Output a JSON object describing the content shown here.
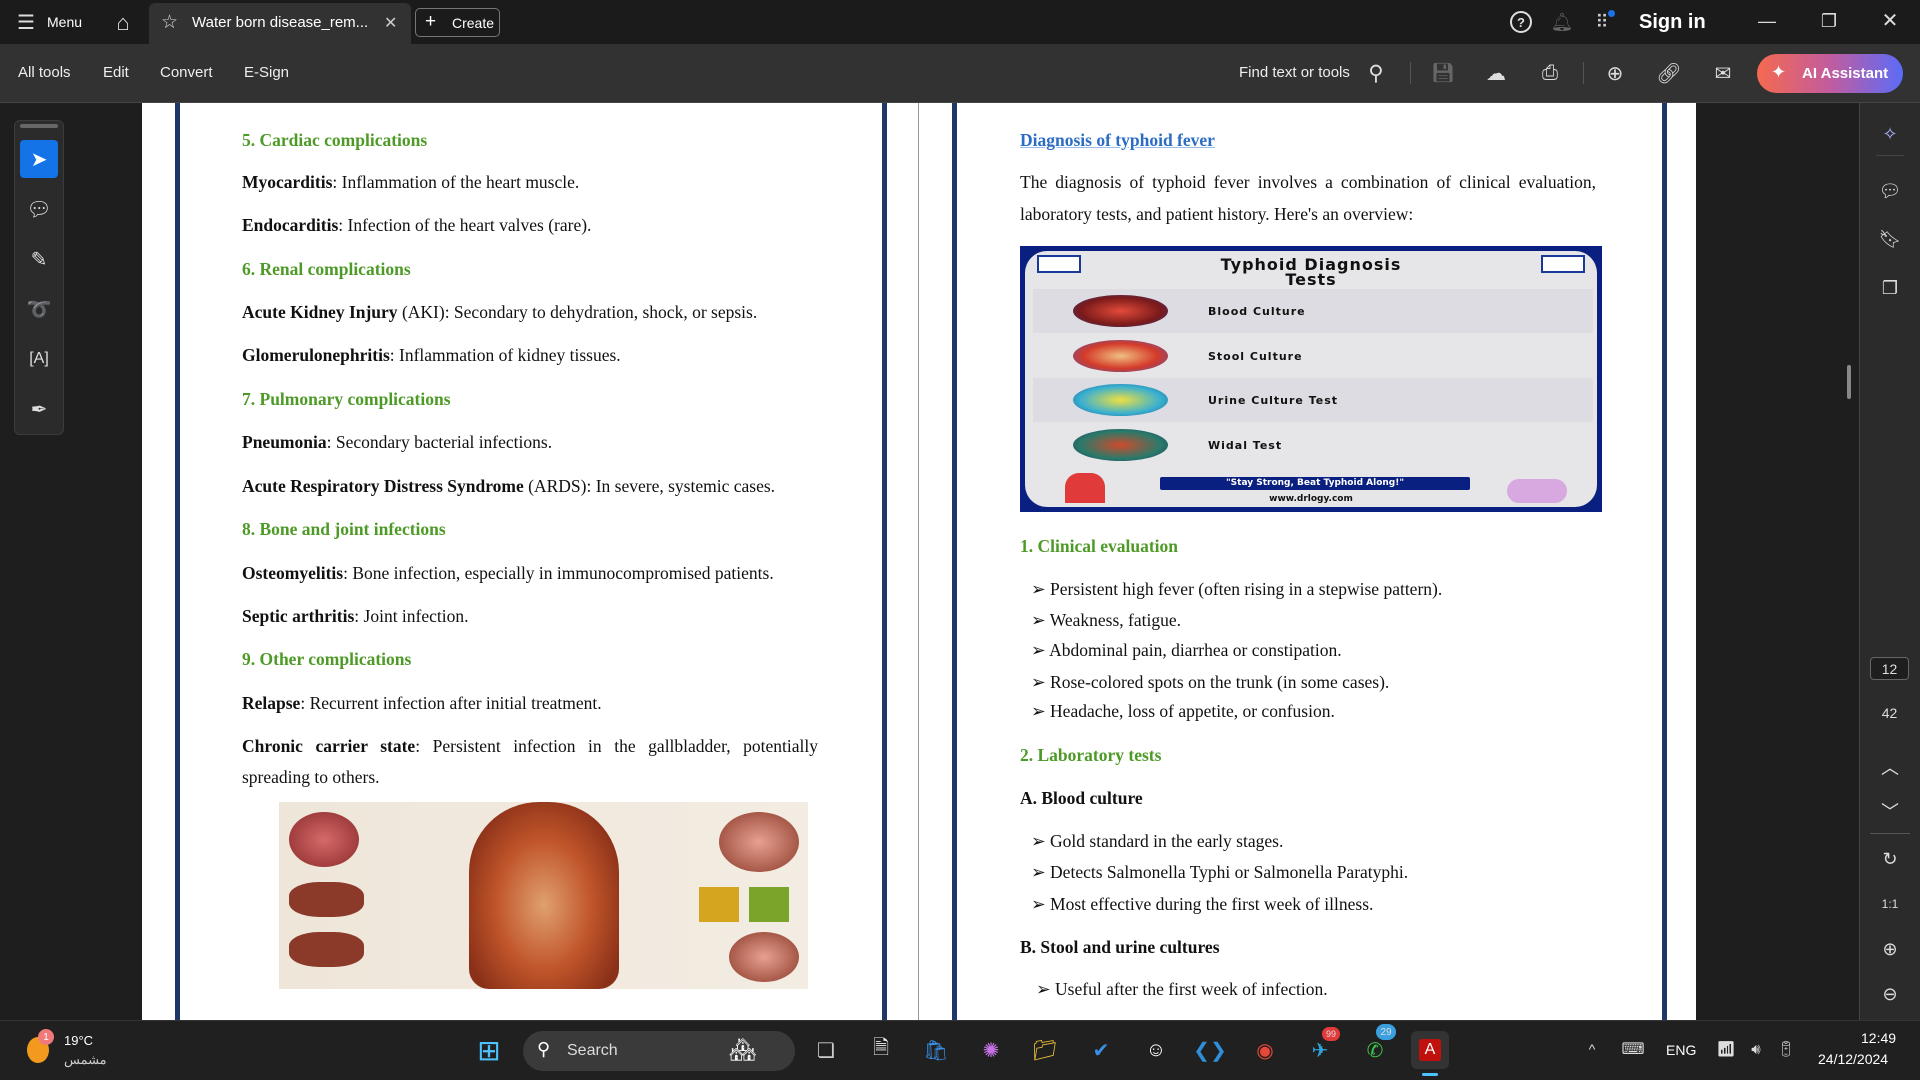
{
  "titlebar": {
    "menu": "Menu",
    "tab_title": "Water born disease_rem...",
    "create": "Create",
    "sign_in": "Sign in"
  },
  "toolbar": {
    "all_tools": "All tools",
    "edit": "Edit",
    "convert": "Convert",
    "esign": "E-Sign",
    "find": "Find text or tools",
    "ai": "AI Assistant"
  },
  "left_page": {
    "h5": "5. Cardiac complications",
    "l1b": "Myocarditis",
    "l1": ": Inflammation of the heart muscle.",
    "l2b": "Endocarditis",
    "l2": ": Infection of the heart valves (rare).",
    "h6": "6. Renal complications",
    "l3b": "Acute Kidney Injury",
    "l3": " (AKI): Secondary to dehydration, shock, or sepsis.",
    "l4b": "Glomerulonephritis",
    "l4": ": Inflammation of kidney tissues.",
    "h7": "7. Pulmonary complications",
    "l5b": "Pneumonia",
    "l5": ": Secondary bacterial infections.",
    "l6b": "Acute Respiratory Distress Syndrome",
    "l6": " (ARDS): In severe, systemic cases.",
    "h8": "8. Bone and joint infections",
    "l7b": "Osteomyelitis",
    "l7": ": Bone infection, especially in immunocompromised patients.",
    "l8b": "Septic arthritis",
    "l8": ": Joint infection.",
    "h9": "9. Other complications",
    "l9b": "Relapse",
    "l9": ": Recurrent infection after initial treatment.",
    "l10b": "Chronic carrier state",
    "l10a": ": Persistent infection in the gallbladder, potentially",
    "l10c": "spreading to others."
  },
  "right_page": {
    "title": "Diagnosis of typhoid fever",
    "intro1": "The diagnosis of typhoid fever involves a combination of clinical evaluation,",
    "intro2": "laboratory tests, and patient history. Here's an overview:",
    "infographic": {
      "title1": "Typhoid Diagnosis",
      "title2": "Tests",
      "rows": [
        "Blood Culture",
        "Stool Culture",
        "Urine Culture Test",
        "Widal Test"
      ],
      "slogan": "\"Stay Strong, Beat Typhoid Along!\"",
      "site": "www.drlogy.com"
    },
    "h1": "1. Clinical evaluation",
    "clinical": [
      "Persistent high fever (often rising in a stepwise pattern).",
      "Weakness, fatigue.",
      "Abdominal pain, diarrhea or constipation.",
      "Rose-colored spots on the trunk (in some cases).",
      "Headache, loss of appetite, or confusion."
    ],
    "h2": "2. Laboratory tests",
    "hA": "A. Blood culture",
    "blood": [
      "Gold standard in the early stages.",
      "Detects Salmonella Typhi or Salmonella Paratyphi.",
      "Most effective during the first week of illness."
    ],
    "hB": "B. Stool and urine cultures",
    "stool": [
      "Useful after the first week of infection."
    ]
  },
  "page_nav": {
    "current": "12",
    "total": "42"
  },
  "taskbar": {
    "temp": "19°C",
    "weather": "مشمس",
    "weather_badge": "1",
    "search": "Search",
    "telegram_badge": "99",
    "whatsapp_badge": "29",
    "lang": "ENG",
    "time": "12:49",
    "date": "24/12/2024"
  },
  "colors": {
    "heading_green": "#4e9a27",
    "title_blue": "#2b6cc4",
    "ai_start": "#f56a4f",
    "ai_end": "#5b6cf8",
    "select_blue": "#1473e6"
  }
}
